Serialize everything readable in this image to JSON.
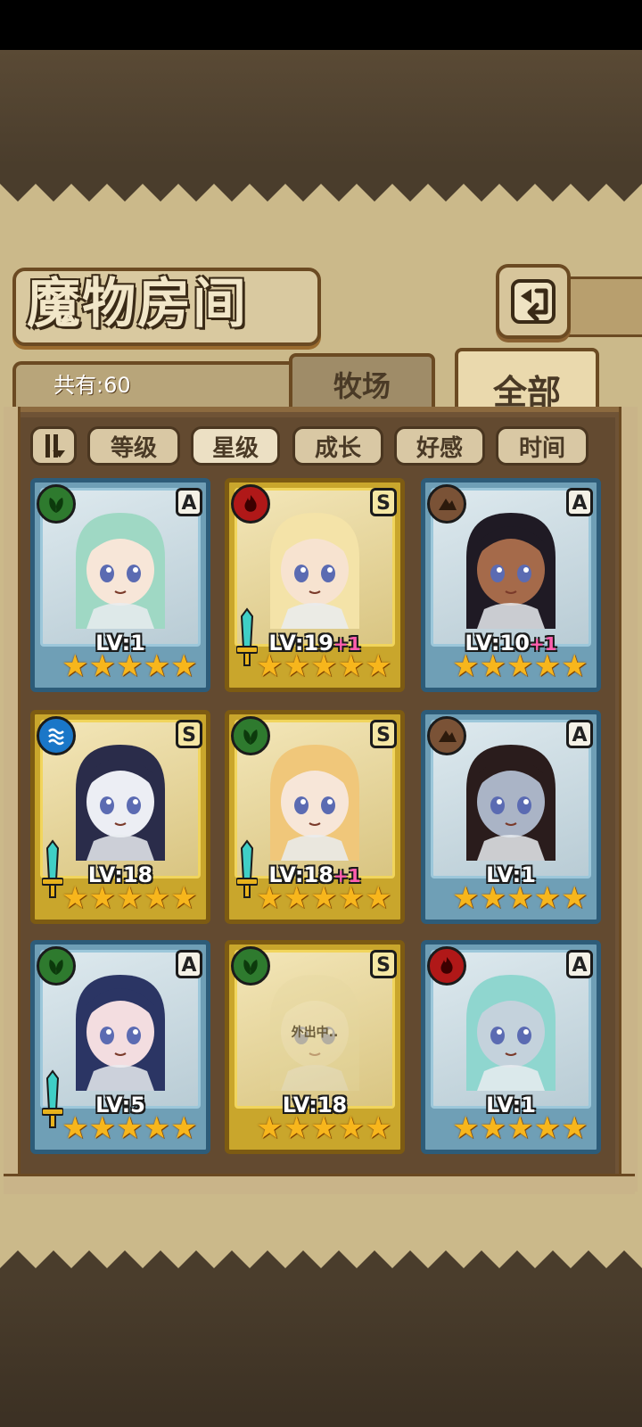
{
  "title": "魔物房间",
  "count_label": "共有:60",
  "tabs": [
    {
      "label": "牧场",
      "active": false
    },
    {
      "label": "全部",
      "active": true
    }
  ],
  "filters": [
    {
      "label": "等级",
      "active": false
    },
    {
      "label": "星级",
      "active": true
    },
    {
      "label": "成长",
      "active": false
    },
    {
      "label": "好感",
      "active": false
    },
    {
      "label": "时间",
      "active": false
    }
  ],
  "icons": {
    "back": "back-arrow-icon",
    "sort_toggle": "sort-toggle-icon"
  },
  "colors": {
    "wood": "#2e7a2e",
    "fire": "#b01818",
    "earth": "#7a5236",
    "water": "#1a77c8",
    "star": "#f7b61c"
  },
  "monsters": [
    {
      "element": "wood",
      "rank": "A",
      "frame": "blue",
      "level": "LV:1",
      "bonus": "",
      "stars": 5,
      "weapon": false,
      "status": "",
      "hair": "#9fd8c4",
      "skin": "#f7e6d8"
    },
    {
      "element": "fire",
      "rank": "S",
      "frame": "gold",
      "level": "LV:19",
      "bonus": "+1",
      "stars": 5,
      "weapon": true,
      "status": "",
      "hair": "#f4e3a8",
      "skin": "#f7e3d0"
    },
    {
      "element": "earth",
      "rank": "A",
      "frame": "blue",
      "level": "LV:10",
      "bonus": "+1",
      "stars": 5,
      "weapon": false,
      "status": "",
      "hair": "#1f1a24",
      "skin": "#a56a4a"
    },
    {
      "element": "water",
      "rank": "S",
      "frame": "gold",
      "level": "LV:18",
      "bonus": "",
      "stars": 5,
      "weapon": true,
      "status": "",
      "hair": "#2a2c4a",
      "skin": "#eceef4"
    },
    {
      "element": "wood",
      "rank": "S",
      "frame": "gold",
      "level": "LV:18",
      "bonus": "+1",
      "stars": 5,
      "weapon": true,
      "status": "",
      "hair": "#f0c77a",
      "skin": "#f7e6d8"
    },
    {
      "element": "earth",
      "rank": "A",
      "frame": "blue",
      "level": "LV:1",
      "bonus": "",
      "stars": 5,
      "weapon": false,
      "status": "",
      "hair": "#2a1c1c",
      "skin": "#aab4c6"
    },
    {
      "element": "wood",
      "rank": "A",
      "frame": "blue",
      "level": "LV:5",
      "bonus": "",
      "stars": 5,
      "weapon": true,
      "status": "",
      "hair": "#2b3564",
      "skin": "#f3dde0"
    },
    {
      "element": "wood",
      "rank": "S",
      "frame": "gold",
      "level": "LV:18",
      "bonus": "",
      "stars": 5,
      "weapon": false,
      "status": "外出中..",
      "hair": "#e4d8a0",
      "skin": "#f0e6c4"
    },
    {
      "element": "fire",
      "rank": "A",
      "frame": "blue",
      "level": "LV:1",
      "bonus": "",
      "stars": 5,
      "weapon": false,
      "status": "",
      "hair": "#8fd6cf",
      "skin": "#c4d2dc"
    }
  ]
}
